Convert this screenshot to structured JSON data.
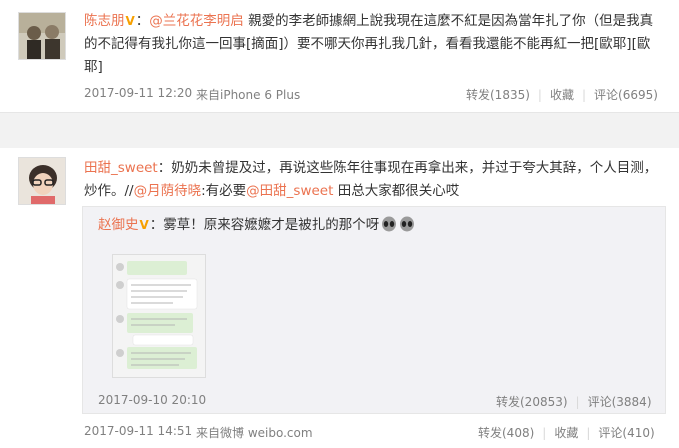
{
  "post1": {
    "username": "陈志朋",
    "verified_icon": "v-badge-icon",
    "mention": "@兰花花李明启",
    "body": " 親愛的李老師據網上說我現在這麼不紅是因為當年扎了你（但是我真的不記得有我扎你這一回事[摘面]）要不哪天你再扎我几針，看看我還能不能再紅一把[歐耶][歐耶]",
    "date": "2017-09-11 12:20",
    "source": "来自iPhone 6 Plus",
    "repost_label": "转发(1835)",
    "favorite_label": "收藏",
    "comment_label": "评论(6695)"
  },
  "post2": {
    "username": "田甜_sweet",
    "body_part1": "：奶奶未曾提及过，再说这些陈年往事现在再拿出来，并过于夸大其辞，个人目测，炒作。//",
    "mention1": "@月荫待晓",
    "body_part2": ":有必要",
    "mention2": "@田甜_sweet",
    "body_part3": " 田总大家都很关心哎",
    "date": "2017-09-11 14:51",
    "source": "来自微博 weibo.com",
    "repost_label": "转发(408)",
    "favorite_label": "收藏",
    "comment_label": "评论(410)"
  },
  "quoted": {
    "username": "赵御史",
    "verified_icon": "v-badge-icon",
    "body": "：雾草！原来容嬷嬷才是被扎的那个呀",
    "emoji": "alien-emoji-icon",
    "date": "2017-09-10 20:10",
    "repost_label": "转发(20853)",
    "comment_label": "评论(3884)"
  },
  "colors": {
    "link": "#eb7350",
    "meta": "#808080",
    "badge": "#f7a000",
    "gap": "#f2f2f2"
  }
}
